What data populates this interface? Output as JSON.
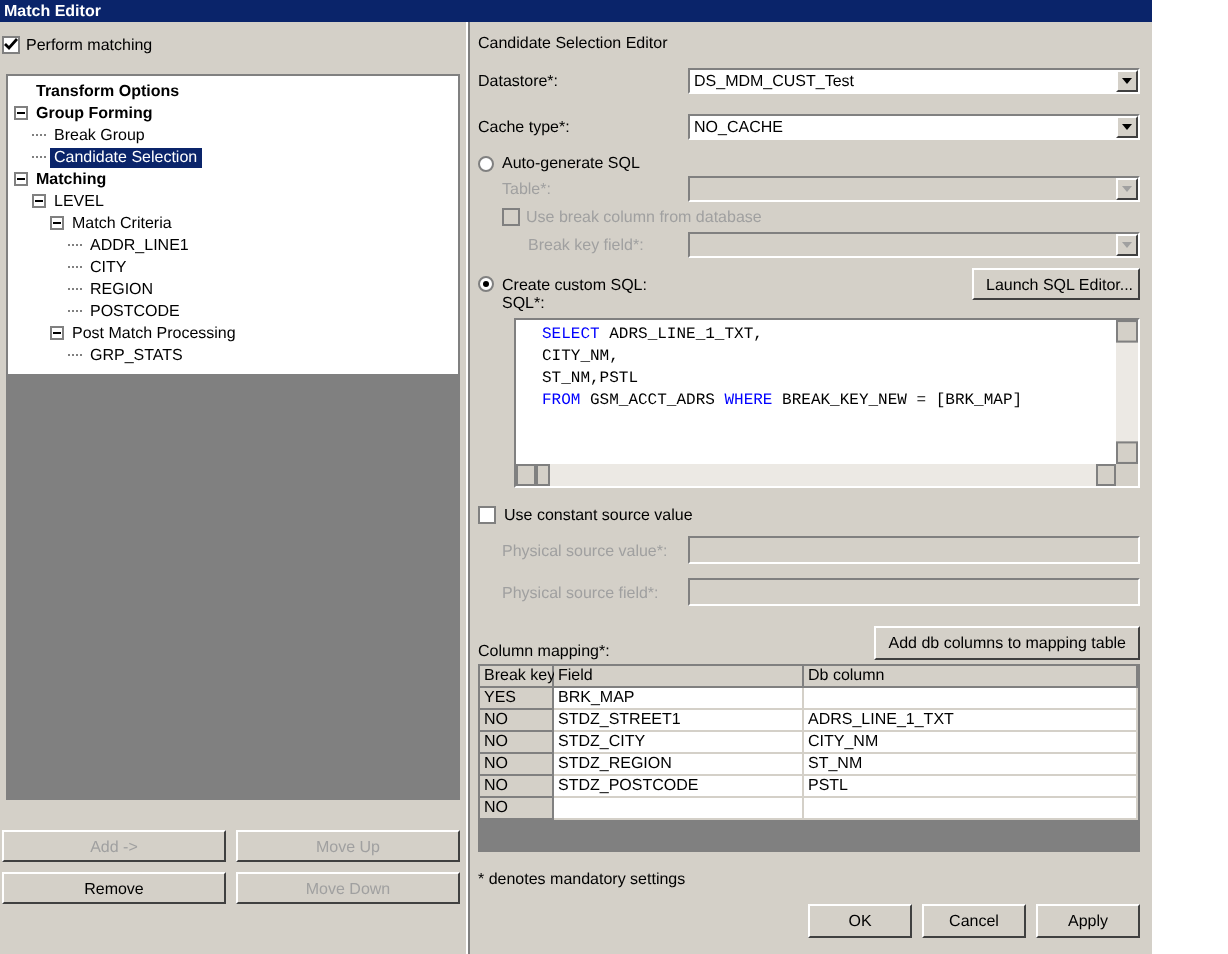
{
  "window": {
    "title": "Match Editor"
  },
  "perform_matching": {
    "label": "Perform matching",
    "checked": true
  },
  "tree": [
    {
      "label": "Transform Options",
      "selected": false
    },
    {
      "label": "Group Forming",
      "selected": false,
      "expanded": true,
      "children": [
        {
          "label": "Break Group",
          "selected": false
        },
        {
          "label": "Candidate Selection",
          "selected": true
        }
      ]
    },
    {
      "label": "Matching",
      "selected": false,
      "expanded": true,
      "children": [
        {
          "label": "LEVEL",
          "selected": false,
          "expanded": true,
          "children": [
            {
              "label": "Match Criteria",
              "selected": false,
              "expanded": true,
              "children": [
                {
                  "label": "ADDR_LINE1",
                  "selected": false
                },
                {
                  "label": "CITY",
                  "selected": false
                },
                {
                  "label": "REGION",
                  "selected": false
                },
                {
                  "label": "POSTCODE",
                  "selected": false
                }
              ]
            },
            {
              "label": "Post Match Processing",
              "selected": false,
              "expanded": true,
              "children": [
                {
                  "label": "GRP_STATS",
                  "selected": false
                }
              ]
            }
          ]
        }
      ]
    }
  ],
  "left_buttons": [
    {
      "label": "Add ->",
      "disabled": true
    },
    {
      "label": "Move Up",
      "disabled": true
    },
    {
      "label": "Remove",
      "disabled": false
    },
    {
      "label": "Move Down",
      "disabled": true
    }
  ],
  "editor": {
    "title": "Candidate Selection Editor",
    "datastore": {
      "label": "Datastore*:",
      "value": "DS_MDM_CUST_Test",
      "disabled": false
    },
    "cache_type": {
      "label": "Cache type*:",
      "value": "NO_CACHE",
      "disabled": false
    },
    "auto_generate": {
      "label": "Auto-generate SQL",
      "selected": false
    },
    "table": {
      "label": "Table*:",
      "disabled": true
    },
    "use_break_column": {
      "label": "Use break column from database",
      "checked": false,
      "disabled": true
    },
    "break_key_field": {
      "label": "Break key field*:",
      "disabled": true
    },
    "custom_sql": {
      "label": "Create custom SQL:",
      "selected": true
    },
    "launch_button": "Launch SQL Editor...",
    "sql_label": "SQL*:",
    "sql_lines": [
      [
        {
          "kind": "keyword",
          "text": "SELECT"
        },
        {
          "kind": "text",
          "text": " ADRS_LINE_1_TXT,"
        }
      ],
      [
        {
          "kind": "text",
          "text": "CITY_NM,"
        }
      ],
      [
        {
          "kind": "text",
          "text": "ST_NM,PSTL"
        }
      ],
      [
        {
          "kind": "keyword",
          "text": "FROM"
        },
        {
          "kind": "text",
          "text": " GSM_ACCT_ADRS "
        },
        {
          "kind": "keyword",
          "text": "WHERE"
        },
        {
          "kind": "text",
          "text": " BREAK_KEY_NEW = [BRK_MAP]"
        }
      ]
    ],
    "use_constant": {
      "label": "Use constant source value",
      "checked": false
    },
    "physical_value": {
      "label": "Physical source value*:",
      "disabled": true
    },
    "physical_field": {
      "label": "Physical source field*:",
      "disabled": true
    },
    "add_columns_button": "Add db columns to mapping table",
    "mapping_label": "Column mapping*:",
    "mapping": {
      "columns": [
        "Break key",
        "Field",
        "Db column"
      ],
      "rows": [
        [
          "YES",
          "BRK_MAP",
          ""
        ],
        [
          "NO",
          "STDZ_STREET1",
          "ADRS_LINE_1_TXT"
        ],
        [
          "NO",
          "STDZ_CITY",
          "CITY_NM"
        ],
        [
          "NO",
          "STDZ_REGION",
          "ST_NM"
        ],
        [
          "NO",
          "STDZ_POSTCODE",
          "PSTL"
        ],
        [
          "NO",
          "",
          ""
        ]
      ]
    },
    "note": "* denotes mandatory settings",
    "buttons": [
      "OK",
      "Cancel",
      "Apply"
    ]
  }
}
